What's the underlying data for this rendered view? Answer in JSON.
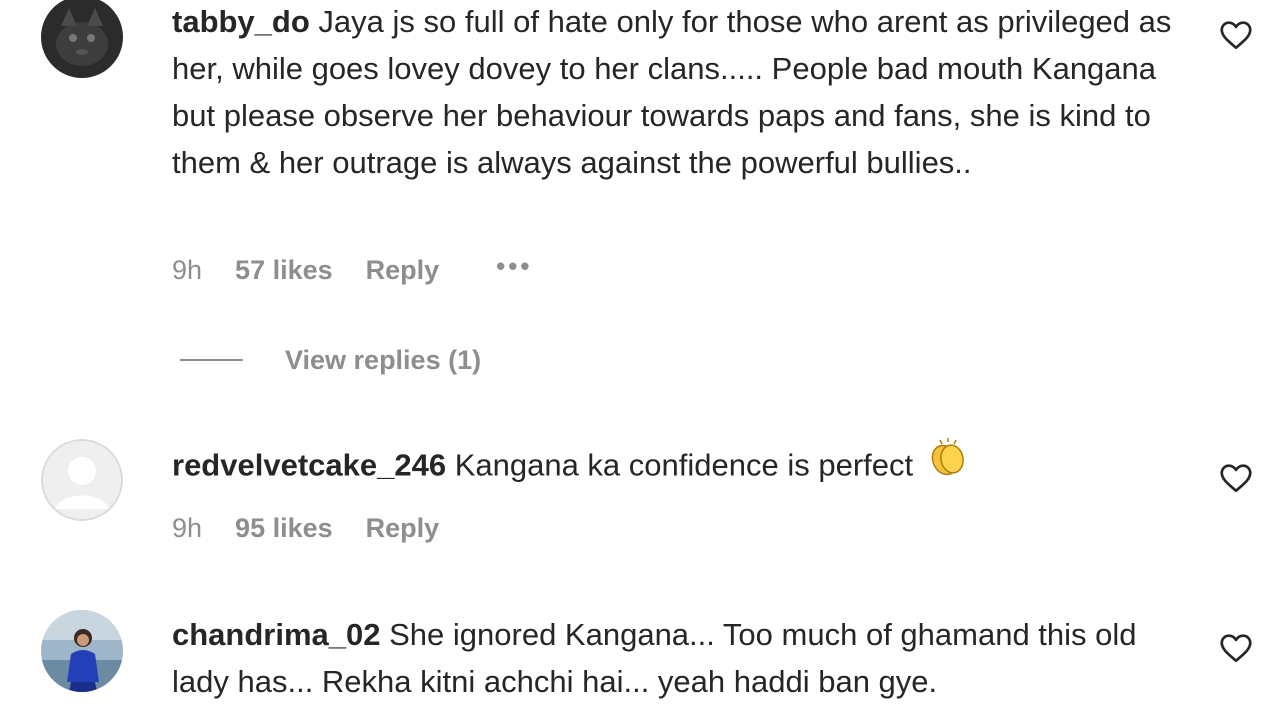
{
  "comments": [
    {
      "username": "tabby_do",
      "text": "Jaya js so full of hate only for those who arent as privileged as her, while goes lovey dovey to her clans..... People bad mouth Kangana but please observe her behaviour towards paps and fans, she is kind to them & her outrage is always against the powerful bullies..",
      "time": "9h",
      "likes": "57 likes",
      "reply": "Reply",
      "more": "•••",
      "view_replies": "View replies (1)",
      "avatar": "dark-cat-avatar"
    },
    {
      "username": "redvelvetcake_246",
      "text": "Kangana ka confidence is perfect",
      "emoji": "clapping-hands-emoji",
      "time": "9h",
      "likes": "95 likes",
      "reply": "Reply",
      "avatar": "default-avatar"
    },
    {
      "username": "chandrima_02",
      "text": "She ignored Kangana... Too much of ghamand this old lady has... Rekha kitni achchi hai... yeah haddi ban gye.",
      "avatar": "woman-blue-dress-avatar"
    }
  ],
  "icons": {
    "like": "heart-outline-icon"
  },
  "colors": {
    "text": "#262626",
    "secondary": "#8e8e8e"
  }
}
